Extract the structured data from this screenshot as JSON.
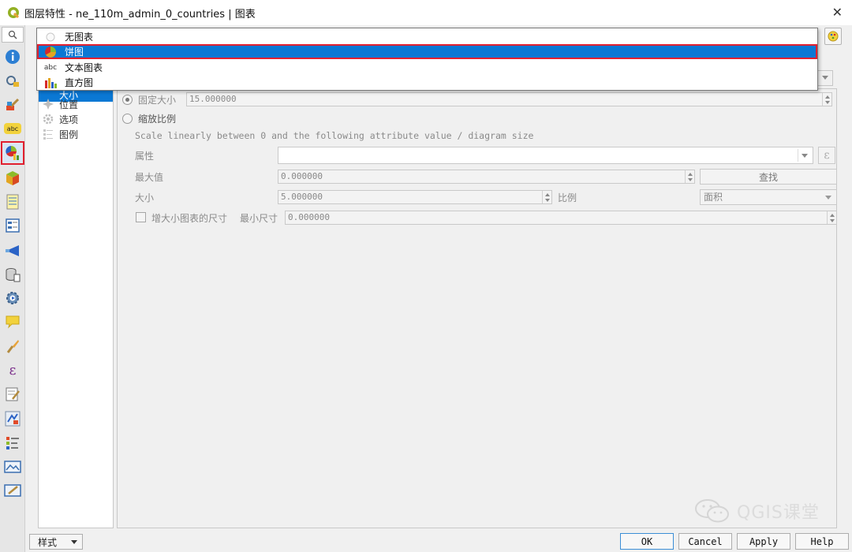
{
  "window": {
    "title": "图层特性 - ne_110m_admin_0_countries | 图表",
    "close_glyph": "✕"
  },
  "left_nav": {
    "items": [
      {
        "name": "info-icon"
      },
      {
        "name": "source-icon"
      },
      {
        "name": "symbology-icon"
      },
      {
        "name": "labels-icon",
        "text": "abc"
      },
      {
        "name": "diagrams-icon",
        "selected": true
      },
      {
        "name": "3d-view-icon"
      },
      {
        "name": "source-fields-icon"
      },
      {
        "name": "attributes-form-icon"
      },
      {
        "name": "joins-icon"
      },
      {
        "name": "auxiliary-storage-icon"
      },
      {
        "name": "actions-icon"
      },
      {
        "name": "display-icon"
      },
      {
        "name": "rendering-icon"
      },
      {
        "name": "variables-icon"
      },
      {
        "name": "metadata-icon"
      },
      {
        "name": "dependencies-icon"
      },
      {
        "name": "legend-icon"
      },
      {
        "name": "qgis-server-icon"
      },
      {
        "name": "digitizing-icon"
      }
    ]
  },
  "dropdown": {
    "options": [
      {
        "label": "无图表",
        "icon": "no-diagram-icon"
      },
      {
        "label": "饼图",
        "icon": "pie-chart-icon",
        "selected": true
      },
      {
        "label": "文本图表",
        "icon": "text-diagram-icon",
        "icon_text": "abc"
      },
      {
        "label": "直方图",
        "icon": "histogram-icon"
      }
    ]
  },
  "subnav": {
    "items": [
      {
        "label": "大小"
      },
      {
        "label": "位置"
      },
      {
        "label": "选项"
      },
      {
        "label": "图例"
      }
    ]
  },
  "size_panel": {
    "fixed_size_label": "固定大小",
    "fixed_size_value": "15.000000",
    "scaled_label": "缩放比例",
    "scale_description": "Scale linearly between 0 and the following attribute value / diagram size",
    "attribute_label": "属性",
    "attribute_value": "",
    "expression_glyph": "ε",
    "max_value_label": "最大值",
    "max_value": "0.000000",
    "find_button": "查找",
    "size_label": "大小",
    "size_value": "5.000000",
    "scale_label": "比例",
    "scale_value": "面积",
    "increase_small_label": "增大小图表的尺寸",
    "min_size_label": "最小尺寸",
    "min_size_value": "0.000000"
  },
  "footer": {
    "style_label": "样式",
    "ok": "OK",
    "cancel": "Cancel",
    "apply": "Apply",
    "help": "Help"
  },
  "watermark": {
    "text": "QGIS课堂"
  },
  "colors": {
    "selection_blue": "#0a78d4",
    "highlight_red": "#e02030"
  }
}
